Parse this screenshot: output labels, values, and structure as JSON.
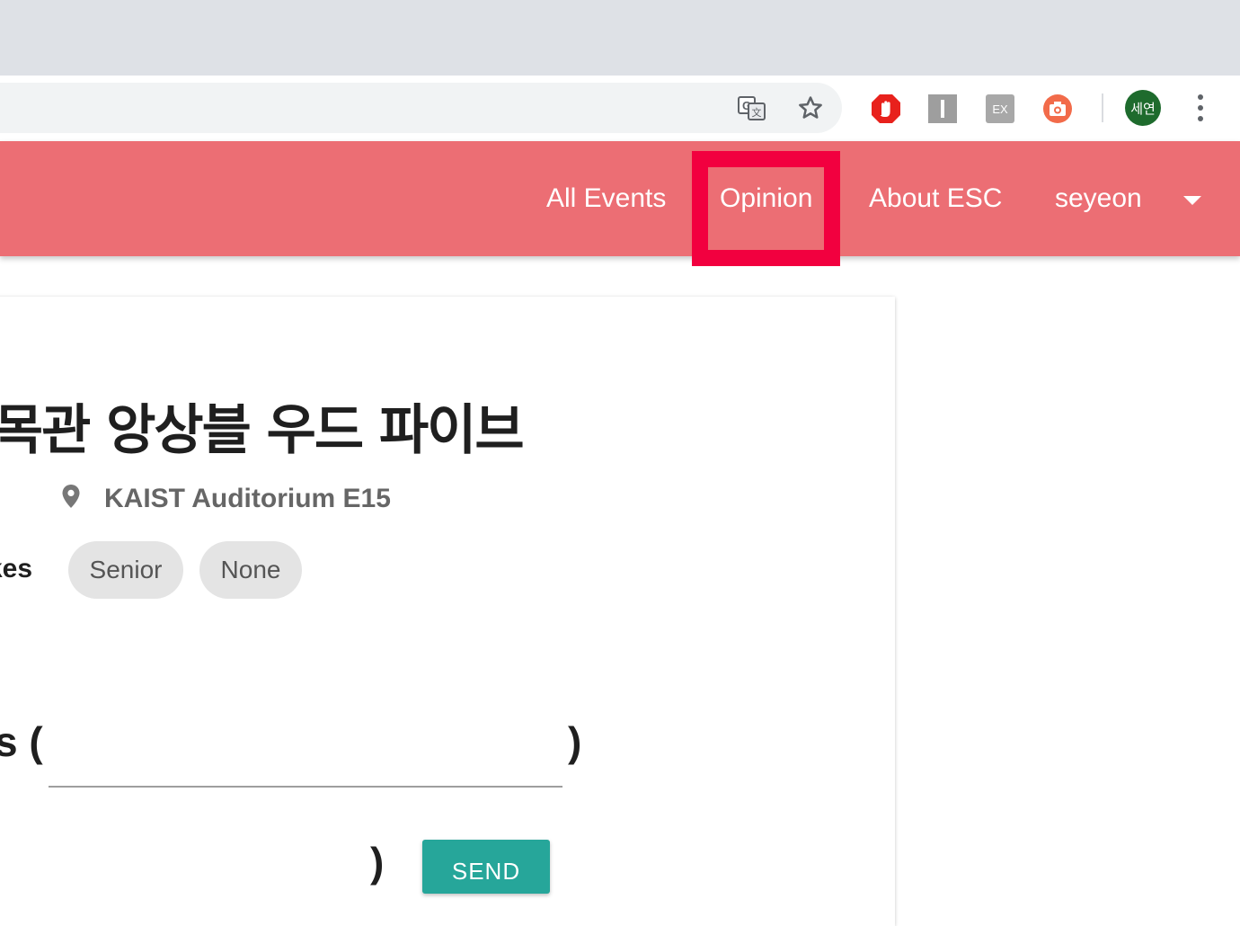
{
  "browser": {
    "extensions": [
      "translate-icon",
      "bookmark-star-icon",
      "adblock-hand-icon",
      "reader-i-icon",
      "ex-extension-icon",
      "screenshot-camera-icon"
    ],
    "profile_initials": "세연",
    "colors": {
      "tabstrip": "#dee1e6",
      "omnibox": "#f1f3f4",
      "profile": "#1e6b2d"
    }
  },
  "navbar": {
    "items": [
      {
        "label": "All Events"
      },
      {
        "label": "Opinion"
      },
      {
        "label": "About ESC"
      },
      {
        "label": "seyeon"
      }
    ],
    "highlighted_item": "Opinion",
    "colors": {
      "background": "#ec6e74",
      "highlight": "#f2003f"
    }
  },
  "event": {
    "title": "-목관 앙상블 우드 파이브",
    "location": "KAIST Auditorium E15",
    "tags_label_partial": "kes",
    "tags": [
      "Senior",
      "None"
    ]
  },
  "form": {
    "label_partial": "s (",
    "close_paren": ")",
    "second_close_paren": ")",
    "input_value": "",
    "send_label": "SEND",
    "colors": {
      "send": "#26a69a"
    }
  }
}
